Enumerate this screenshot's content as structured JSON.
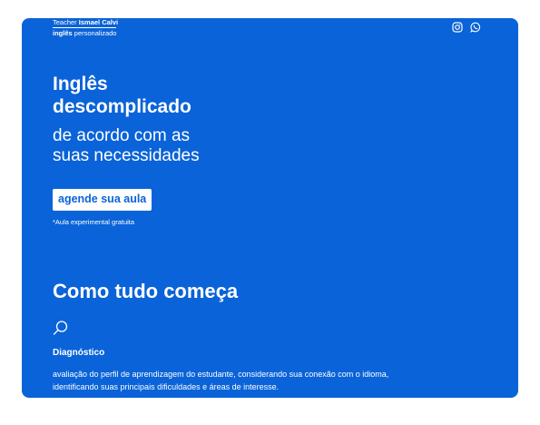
{
  "brand": {
    "prefix": "Teacher",
    "name": "Ismael Calvi",
    "tagline_bold": "inglês",
    "tagline": "personalizado"
  },
  "social": {
    "icons": [
      "instagram-icon",
      "whatsapp-icon"
    ]
  },
  "hero": {
    "title_line1": "Inglês",
    "title_line2": "descomplicado",
    "subtitle_line1": "de acordo com as",
    "subtitle_line2": "suas necessidades"
  },
  "cta": {
    "label": "agende sua aula",
    "note": "*Aula experimental gratuita"
  },
  "section": {
    "title": "Como tudo começa",
    "step": {
      "icon": "search-icon",
      "title": "Diagnóstico",
      "desc_line1": "avaliação do perfil de aprendizagem do estudante, considerando sua conexão com o idioma,",
      "desc_line2": "identificando suas principais dificuldades e áreas de interesse."
    }
  },
  "colors": {
    "background": "#0a63d8",
    "text": "#ffffff"
  }
}
